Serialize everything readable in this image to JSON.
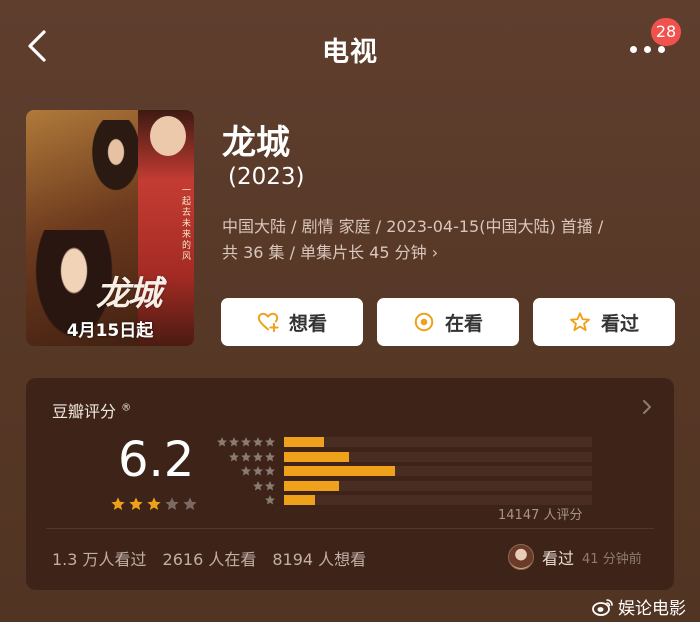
{
  "header": {
    "title": "电视",
    "notification_count": "28"
  },
  "poster": {
    "logo_text": "龙城",
    "date_text": "4月15日起",
    "tagline": "一起去未来的风"
  },
  "movie": {
    "title": "龙城",
    "year": "(2023)",
    "meta_line1": "中国大陆 / 剧情 家庭 / 2023-04-15(中国大陆) 首播 /",
    "meta_line2": "共 36 集 / 单集片长 45 分钟"
  },
  "actions": [
    {
      "label": "想看",
      "icon": "heart-plus-icon"
    },
    {
      "label": "在看",
      "icon": "target-icon"
    },
    {
      "label": "看过",
      "icon": "star-outline-icon"
    }
  ],
  "rating": {
    "title": "豆瓣评分",
    "registered_mark": "®",
    "score": "6.2",
    "stars_filled": 3,
    "stars_total": 5,
    "distribution": [
      {
        "stars": 5,
        "fraction": 0.13
      },
      {
        "stars": 4,
        "fraction": 0.21
      },
      {
        "stars": 3,
        "fraction": 0.36
      },
      {
        "stars": 2,
        "fraction": 0.18
      },
      {
        "stars": 1,
        "fraction": 0.1
      }
    ],
    "vote_count": "14147 人评分"
  },
  "stats": {
    "watched": "1.3 万人看过",
    "watching": "2616 人在看",
    "want": "8194 人想看"
  },
  "friend": {
    "action": "看过",
    "time": "41 分钟前"
  },
  "watermark": {
    "text": "娱论电影"
  },
  "colors": {
    "background": "#5a3a2b",
    "panel": "#3d2318",
    "accent_orange": "#f0a11a",
    "badge_red": "#f2524e"
  }
}
